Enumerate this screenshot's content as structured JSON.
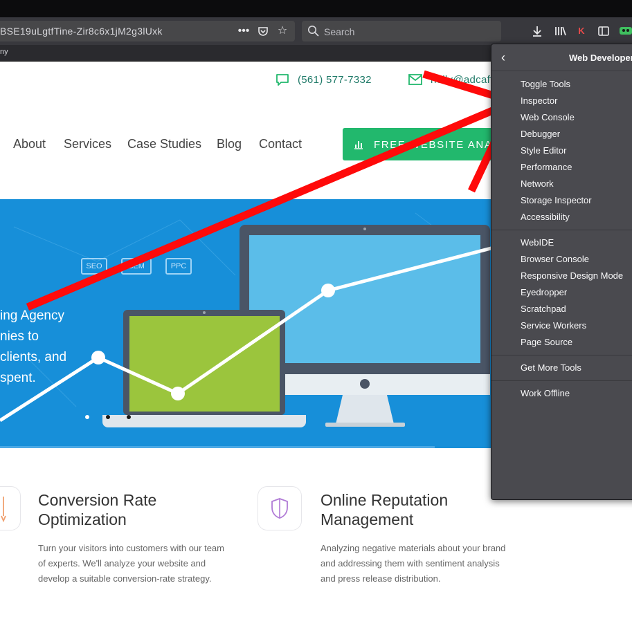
{
  "browser": {
    "url_fragment": "BSE19uLgtfTine-Zir8c6x1jM2g3lUxk",
    "search_placeholder": "Search",
    "bookmark_fragment": "ny"
  },
  "website": {
    "phone": "(561) 577-7332",
    "email_fragment": "holly@adcaff",
    "nav": [
      "About",
      "Services",
      "Case Studies",
      "Blog",
      "Contact"
    ],
    "cta_label": "FREE WEBSITE ANALY",
    "hero_tags": [
      "SEO",
      "SEM",
      "PPC"
    ],
    "hero_lines": [
      "ing Agency",
      "nies to",
      "clients, and",
      "spent."
    ],
    "features": [
      {
        "title_lines": [
          "Conversion Rate",
          "Optimization"
        ],
        "desc_lines": [
          "Turn your visitors into customers with our team",
          "of experts. We'll analyze your website and",
          "develop a suitable conversion-rate strategy."
        ]
      },
      {
        "title_lines": [
          "Online Reputation",
          "Management"
        ],
        "desc_lines": [
          "Analyzing negative materials about your brand",
          "and addressing them with sentiment analysis",
          "and press release distribution."
        ]
      }
    ]
  },
  "dev_menu": {
    "title": "Web Developer",
    "group1": [
      "Toggle Tools",
      "Inspector",
      "Web Console",
      "Debugger",
      "Style Editor",
      "Performance",
      "Network",
      "Storage Inspector",
      "Accessibility"
    ],
    "group2": [
      "WebIDE",
      "Browser Console",
      "Responsive Design Mode",
      "Eyedropper",
      "Scratchpad",
      "Service Workers",
      "Page Source"
    ],
    "group3": [
      "Get More Tools"
    ],
    "group4": [
      "Work Offline"
    ]
  },
  "colors": {
    "accent_green": "#22b86d",
    "hero_blue": "#178fd9",
    "annotation_red": "#ff0a0a",
    "panel_bg": "#4a4a4f"
  },
  "icons": [
    "back-chevron-icon",
    "phone-chat-icon",
    "email-icon",
    "bar-chart-icon",
    "search-icon",
    "download-icon",
    "library-icon",
    "sidebar-icon",
    "more-icon",
    "pocket-icon",
    "bookmark-star-icon",
    "shield-icon"
  ]
}
